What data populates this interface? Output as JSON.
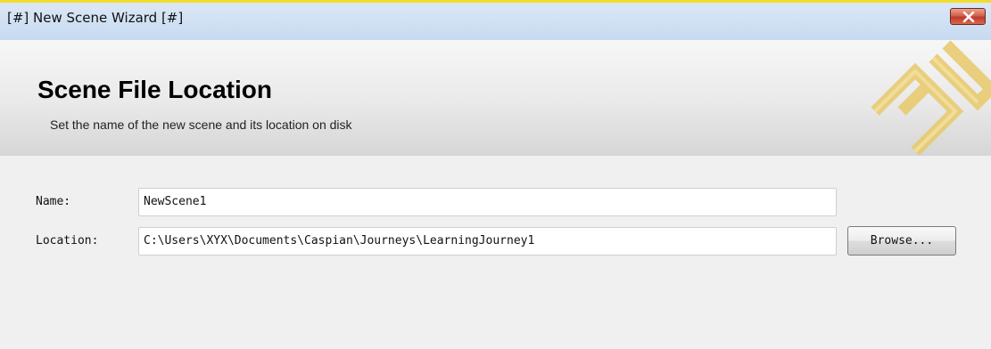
{
  "window": {
    "title": "[#] New Scene Wizard [#]"
  },
  "header": {
    "title": "Scene File Location",
    "subtitle": "Set the name of the new scene and its location on disk"
  },
  "form": {
    "name_label": "Name:",
    "name_value": "NewScene1",
    "location_label": "Location:",
    "location_value": "C:\\Users\\XYX\\Documents\\Caspian\\Journeys\\LearningJourney1",
    "browse_label": "Browse..."
  },
  "colors": {
    "title_bar": "#c7daf1",
    "accent_line": "#f2dc2b",
    "close_button": "#c0392b",
    "logo": "#e8c96a"
  },
  "icons": {
    "close": "close-icon",
    "logo": "caspian-logo"
  }
}
